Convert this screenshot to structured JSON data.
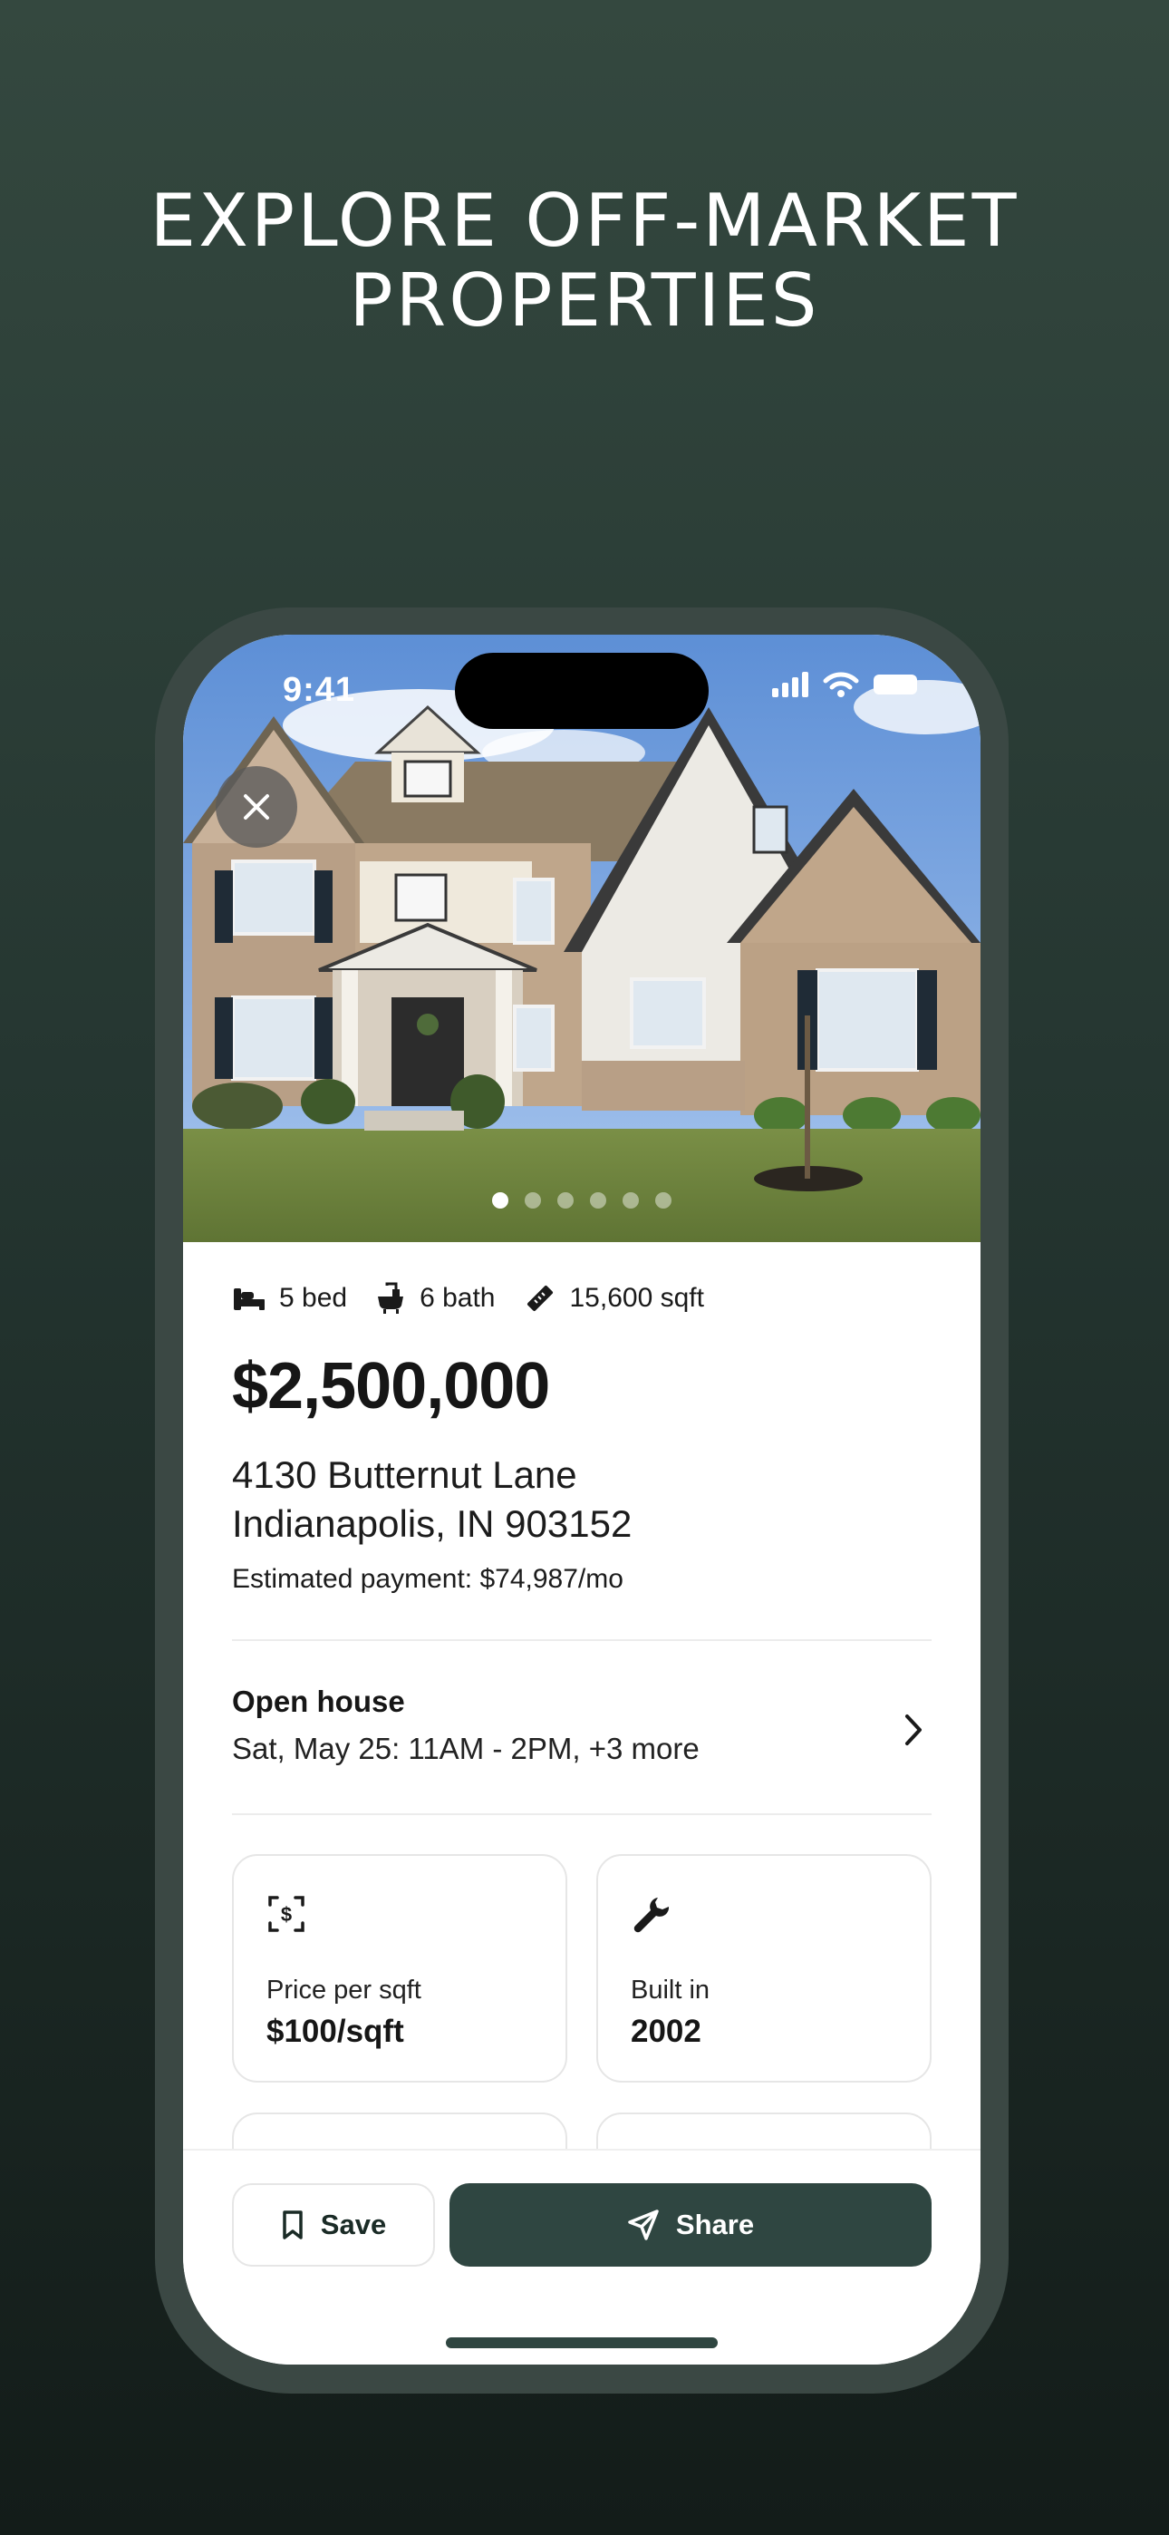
{
  "headline": {
    "line1": "EXPLORE OFF-MARKET",
    "line2": "PROPERTIES"
  },
  "status_bar": {
    "time": "9:41"
  },
  "gallery": {
    "photo_count": 6,
    "active_index": 0
  },
  "listing": {
    "specs": [
      {
        "icon": "bed-icon",
        "label": "5 bed"
      },
      {
        "icon": "bathtub-icon",
        "label": "6 bath"
      },
      {
        "icon": "ruler-icon",
        "label": "15,600 sqft"
      }
    ],
    "price": "$2,500,000",
    "address_line1": "4130 Butternut Lane",
    "address_line2": "Indianapolis, IN 903152",
    "estimated_payment": "Estimated payment: $74,987/mo"
  },
  "open_house": {
    "title": "Open house",
    "date": "Sat, May 25: 11AM - 2PM, +3 more"
  },
  "facts": [
    {
      "icon": "dollar-scan-icon",
      "label": "Price per sqft",
      "value": "$100/sqft"
    },
    {
      "icon": "wrench-icon",
      "label": "Built in",
      "value": "2002"
    }
  ],
  "actions": {
    "save_label": "Save",
    "share_label": "Share"
  },
  "colors": {
    "accent": "#2f4641",
    "background_top": "#34483f",
    "background_bottom": "#131c19"
  }
}
